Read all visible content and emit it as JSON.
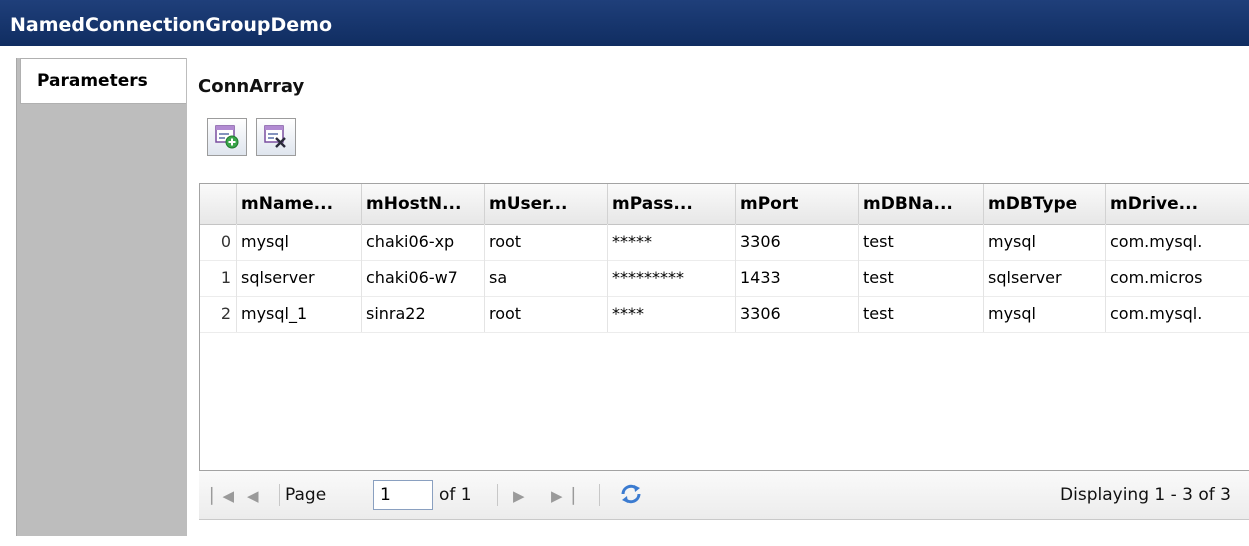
{
  "window": {
    "title": "NamedConnectionGroupDemo"
  },
  "tabs": [
    {
      "label": "Parameters",
      "selected": true
    }
  ],
  "panel": {
    "title": "ConnArray"
  },
  "toolbar": {
    "add_icon": "add-row-icon",
    "remove_icon": "delete-row-icon"
  },
  "grid": {
    "columns": [
      "mName...",
      "mHostN...",
      "mUser...",
      "mPass...",
      "mPort",
      "mDBNa...",
      "mDBType",
      "mDrive..."
    ],
    "rows": [
      {
        "index": "0",
        "cells": [
          "mysql",
          "chaki06-xp",
          "root",
          "*****",
          "3306",
          "test",
          "mysql",
          "com.mysql."
        ]
      },
      {
        "index": "1",
        "cells": [
          "sqlserver",
          "chaki06-w7",
          "sa",
          "*********",
          "1433",
          "test",
          "sqlserver",
          "com.micros"
        ]
      },
      {
        "index": "2",
        "cells": [
          "mysql_1",
          "sinra22",
          "root",
          "****",
          "3306",
          "test",
          "mysql",
          "com.mysql."
        ]
      }
    ]
  },
  "pager": {
    "page_label": "Page",
    "page_value": "1",
    "of_label": "of 1",
    "display_text": "Displaying 1 - 3 of 3"
  },
  "colors": {
    "titlebar": "#163467",
    "tab_background": "#bdbdbd",
    "refresh_icon": "#3b7bd0"
  }
}
